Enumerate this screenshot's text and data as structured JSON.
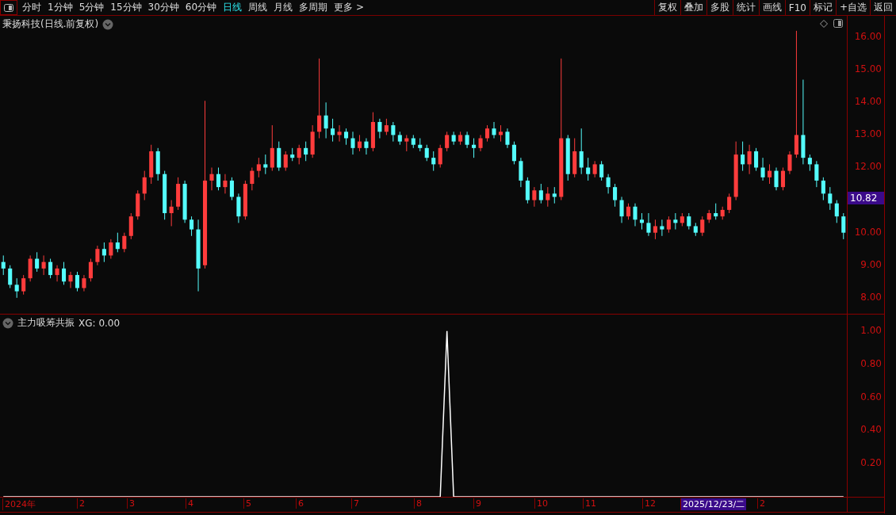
{
  "toolbar": {
    "periods": [
      {
        "label": "分时",
        "selected": false
      },
      {
        "label": "1分钟",
        "selected": false
      },
      {
        "label": "5分钟",
        "selected": false
      },
      {
        "label": "15分钟",
        "selected": false
      },
      {
        "label": "30分钟",
        "selected": false
      },
      {
        "label": "60分钟",
        "selected": false
      },
      {
        "label": "日线",
        "selected": true
      },
      {
        "label": "周线",
        "selected": false
      },
      {
        "label": "月线",
        "selected": false
      },
      {
        "label": "多周期",
        "selected": false
      }
    ],
    "more": "更多 >",
    "buttons": [
      "复权",
      "叠加",
      "多股",
      "统计",
      "画线",
      "F10",
      "标记",
      "+自选",
      "返回"
    ]
  },
  "main_chart": {
    "title": "秉扬科技(日线.前复权)",
    "current_price": "10.82",
    "chart_data": {
      "type": "candlestick",
      "ylim": [
        7.51,
        16.66
      ],
      "yticks": [
        {
          "value": 16,
          "label": "16.00"
        },
        {
          "value": 15,
          "label": "15.00"
        },
        {
          "value": 14,
          "label": "14.00"
        },
        {
          "value": 13,
          "label": "13.00"
        },
        {
          "value": 12,
          "label": "12.00"
        },
        {
          "value": 10,
          "label": "10.00"
        },
        {
          "value": 9,
          "label": "9.00"
        },
        {
          "value": 8,
          "label": "8.00"
        }
      ],
      "categories": [
        null,
        null,
        null,
        null,
        null,
        null,
        null,
        null,
        null,
        null,
        null,
        null,
        null,
        null,
        null,
        null,
        null,
        null,
        null,
        null,
        null,
        null,
        null,
        null,
        null,
        null,
        null,
        null,
        null,
        null,
        null,
        null,
        null,
        null,
        null,
        null,
        null,
        null,
        null,
        null,
        null,
        null,
        null,
        null,
        null,
        null,
        null,
        null,
        null,
        null,
        null,
        null,
        null,
        null,
        null,
        null,
        null,
        null,
        null,
        null,
        null,
        null,
        null,
        null,
        null,
        null,
        null,
        null,
        null,
        null,
        null,
        null,
        null,
        null,
        null,
        null,
        null,
        null,
        null,
        null,
        null,
        null,
        null,
        null,
        null,
        null,
        null,
        null,
        null,
        null,
        null,
        null,
        null,
        null,
        null,
        null,
        null,
        null,
        null,
        null,
        null,
        null,
        null,
        null,
        null,
        null,
        null,
        null,
        null,
        null,
        null,
        null,
        null,
        null,
        null,
        null,
        null,
        null,
        null,
        null,
        null,
        null,
        null,
        null,
        null,
        null
      ],
      "ohlc": [
        [
          9.1,
          9.3,
          8.7,
          8.9
        ],
        [
          8.9,
          9.0,
          8.3,
          8.4
        ],
        [
          8.4,
          8.6,
          8.0,
          8.2
        ],
        [
          8.2,
          8.7,
          8.1,
          8.6
        ],
        [
          8.6,
          9.3,
          8.5,
          9.2
        ],
        [
          9.2,
          9.4,
          8.8,
          8.9
        ],
        [
          8.9,
          9.3,
          8.7,
          9.1
        ],
        [
          9.1,
          9.2,
          8.6,
          8.7
        ],
        [
          8.7,
          9.0,
          8.5,
          8.9
        ],
        [
          8.9,
          9.1,
          8.4,
          8.5
        ],
        [
          8.5,
          8.8,
          8.3,
          8.7
        ],
        [
          8.7,
          8.8,
          8.2,
          8.3
        ],
        [
          8.3,
          8.7,
          8.2,
          8.6
        ],
        [
          8.6,
          9.2,
          8.5,
          9.1
        ],
        [
          9.1,
          9.6,
          9.0,
          9.5
        ],
        [
          9.5,
          9.7,
          9.1,
          9.3
        ],
        [
          9.3,
          9.8,
          9.2,
          9.7
        ],
        [
          9.7,
          10.0,
          9.4,
          9.5
        ],
        [
          9.5,
          10.0,
          9.4,
          9.9
        ],
        [
          9.9,
          10.6,
          9.8,
          10.5
        ],
        [
          10.5,
          11.3,
          10.4,
          11.2
        ],
        [
          11.2,
          11.9,
          11.0,
          11.7
        ],
        [
          11.7,
          12.7,
          11.5,
          12.5
        ],
        [
          12.5,
          12.6,
          11.6,
          11.8
        ],
        [
          11.8,
          11.9,
          10.4,
          10.6
        ],
        [
          10.6,
          11.0,
          10.2,
          10.8
        ],
        [
          10.8,
          11.7,
          10.7,
          11.5
        ],
        [
          11.5,
          11.6,
          10.3,
          10.4
        ],
        [
          10.4,
          10.5,
          9.9,
          10.1
        ],
        [
          10.1,
          10.4,
          8.2,
          8.9
        ],
        [
          9.0,
          14.05,
          8.9,
          11.6
        ],
        [
          11.6,
          12.0,
          11.3,
          11.8
        ],
        [
          11.8,
          12.0,
          11.3,
          11.4
        ],
        [
          11.4,
          11.8,
          11.2,
          11.6
        ],
        [
          11.6,
          11.7,
          11.0,
          11.1
        ],
        [
          11.1,
          11.2,
          10.3,
          10.5
        ],
        [
          10.5,
          11.6,
          10.4,
          11.5
        ],
        [
          11.5,
          12.0,
          11.3,
          11.9
        ],
        [
          11.9,
          12.3,
          11.7,
          12.1
        ],
        [
          12.1,
          12.4,
          11.8,
          12.0
        ],
        [
          12.0,
          13.3,
          11.9,
          12.6
        ],
        [
          12.6,
          12.8,
          11.9,
          12.0
        ],
        [
          12.0,
          12.5,
          11.9,
          12.4
        ],
        [
          12.4,
          12.6,
          12.2,
          12.3
        ],
        [
          12.3,
          12.7,
          12.1,
          12.6
        ],
        [
          12.6,
          12.8,
          12.2,
          12.4
        ],
        [
          12.4,
          13.3,
          12.3,
          13.1
        ],
        [
          13.1,
          15.35,
          12.9,
          13.6
        ],
        [
          13.6,
          14.0,
          12.9,
          13.2
        ],
        [
          13.2,
          13.5,
          12.8,
          13.0
        ],
        [
          13.0,
          13.3,
          12.8,
          13.1
        ],
        [
          13.1,
          13.2,
          12.7,
          12.9
        ],
        [
          12.9,
          13.1,
          12.4,
          12.6
        ],
        [
          12.6,
          13.0,
          12.5,
          12.8
        ],
        [
          12.8,
          12.9,
          12.4,
          12.6
        ],
        [
          12.6,
          13.7,
          12.5,
          13.4
        ],
        [
          13.4,
          13.5,
          12.9,
          13.1
        ],
        [
          13.1,
          13.5,
          13.0,
          13.3
        ],
        [
          13.3,
          13.4,
          12.8,
          13.0
        ],
        [
          13.0,
          13.1,
          12.7,
          12.8
        ],
        [
          12.8,
          13.0,
          12.5,
          12.9
        ],
        [
          12.9,
          13.0,
          12.6,
          12.7
        ],
        [
          12.7,
          12.9,
          12.5,
          12.6
        ],
        [
          12.6,
          12.7,
          12.2,
          12.3
        ],
        [
          12.3,
          12.5,
          11.9,
          12.1
        ],
        [
          12.1,
          12.7,
          12.0,
          12.6
        ],
        [
          12.6,
          13.1,
          12.5,
          13.0
        ],
        [
          13.0,
          13.1,
          12.7,
          12.8
        ],
        [
          12.8,
          13.1,
          12.7,
          13.0
        ],
        [
          13.0,
          13.1,
          12.6,
          12.7
        ],
        [
          12.7,
          12.9,
          12.3,
          12.6
        ],
        [
          12.6,
          13.0,
          12.5,
          12.9
        ],
        [
          12.9,
          13.3,
          12.8,
          13.2
        ],
        [
          13.2,
          13.4,
          12.9,
          13.0
        ],
        [
          13.0,
          13.3,
          12.8,
          13.1
        ],
        [
          13.1,
          13.2,
          12.6,
          12.7
        ],
        [
          12.7,
          12.8,
          12.1,
          12.2
        ],
        [
          12.2,
          12.3,
          11.4,
          11.6
        ],
        [
          11.6,
          11.7,
          10.9,
          11.0
        ],
        [
          11.0,
          11.4,
          10.8,
          11.3
        ],
        [
          11.3,
          11.5,
          10.9,
          11.0
        ],
        [
          11.0,
          11.4,
          10.8,
          11.2
        ],
        [
          11.2,
          11.4,
          10.9,
          11.1
        ],
        [
          11.1,
          15.35,
          11.0,
          12.9
        ],
        [
          12.9,
          13.0,
          11.6,
          11.8
        ],
        [
          11.8,
          12.9,
          11.7,
          12.5
        ],
        [
          12.5,
          13.2,
          11.8,
          12.0
        ],
        [
          12.0,
          12.3,
          11.6,
          11.8
        ],
        [
          11.8,
          12.2,
          11.7,
          12.1
        ],
        [
          12.1,
          12.2,
          11.6,
          11.7
        ],
        [
          11.7,
          11.8,
          11.2,
          11.4
        ],
        [
          11.4,
          11.5,
          10.8,
          11.0
        ],
        [
          11.0,
          11.1,
          10.3,
          10.5
        ],
        [
          10.5,
          10.9,
          10.4,
          10.8
        ],
        [
          10.8,
          10.9,
          10.2,
          10.4
        ],
        [
          10.4,
          10.6,
          10.1,
          10.3
        ],
        [
          10.3,
          10.6,
          9.9,
          10.0
        ],
        [
          10.0,
          10.4,
          9.8,
          10.2
        ],
        [
          10.2,
          10.4,
          9.9,
          10.1
        ],
        [
          10.1,
          10.5,
          10.0,
          10.4
        ],
        [
          10.4,
          10.6,
          10.1,
          10.3
        ],
        [
          10.3,
          10.6,
          10.2,
          10.5
        ],
        [
          10.5,
          10.6,
          10.1,
          10.2
        ],
        [
          10.2,
          10.3,
          9.9,
          10.0
        ],
        [
          10.0,
          10.5,
          9.9,
          10.4
        ],
        [
          10.4,
          10.7,
          10.3,
          10.6
        ],
        [
          10.6,
          10.9,
          10.4,
          10.5
        ],
        [
          10.5,
          10.8,
          10.4,
          10.7
        ],
        [
          10.7,
          11.2,
          10.6,
          11.1
        ],
        [
          11.1,
          12.8,
          11.0,
          12.4
        ],
        [
          12.4,
          12.8,
          11.9,
          12.1
        ],
        [
          12.1,
          12.7,
          11.8,
          12.5
        ],
        [
          12.5,
          12.6,
          11.9,
          12.0
        ],
        [
          12.0,
          12.3,
          11.6,
          11.7
        ],
        [
          11.7,
          12.1,
          11.5,
          11.9
        ],
        [
          11.9,
          12.0,
          11.3,
          11.4
        ],
        [
          11.4,
          12.0,
          11.3,
          11.9
        ],
        [
          11.9,
          12.5,
          11.8,
          12.4
        ],
        [
          12.4,
          16.2,
          12.3,
          13.0
        ],
        [
          13.0,
          14.7,
          12.1,
          12.3
        ],
        [
          12.3,
          12.4,
          11.9,
          12.1
        ],
        [
          12.1,
          12.2,
          11.4,
          11.6
        ],
        [
          11.6,
          11.7,
          11.0,
          11.2
        ],
        [
          11.2,
          11.4,
          10.7,
          10.9
        ],
        [
          10.9,
          11.0,
          10.3,
          10.5
        ],
        [
          10.5,
          10.6,
          9.8,
          10.0
        ]
      ]
    }
  },
  "indicator": {
    "title": "主力吸筹共振",
    "reading": "XG: 0.00",
    "chart_data": {
      "type": "line",
      "categories": [
        null,
        null,
        null,
        null,
        null,
        null,
        null,
        null,
        null,
        null,
        null,
        null,
        null,
        null,
        null,
        null,
        null,
        null,
        null,
        null,
        null,
        null,
        null,
        null,
        null,
        null,
        null,
        null,
        null,
        null,
        null,
        null,
        null,
        null,
        null,
        null,
        null,
        null,
        null,
        null,
        null,
        null,
        null,
        null,
        null,
        null,
        null,
        null,
        null,
        null,
        null,
        null,
        null,
        null,
        null,
        null,
        null,
        null,
        null,
        null,
        null,
        null,
        null,
        null,
        null,
        null,
        null,
        null,
        null,
        null,
        null,
        null,
        null,
        null,
        null,
        null,
        null,
        null,
        null,
        null,
        null,
        null,
        null,
        null,
        null,
        null,
        null,
        null,
        null,
        null,
        null,
        null,
        null,
        null,
        null,
        null,
        null,
        null,
        null,
        null,
        null,
        null,
        null,
        null,
        null,
        null,
        null,
        null,
        null,
        null,
        null,
        null,
        null,
        null,
        null,
        null,
        null,
        null,
        null,
        null,
        null,
        null,
        null,
        null,
        null,
        null
      ],
      "series": [
        {
          "color": "#ffffff",
          "values": [
            0,
            0,
            0,
            0,
            0,
            0,
            0,
            0,
            0,
            0,
            0,
            0,
            0,
            0,
            0,
            0,
            0,
            0,
            0,
            0,
            0,
            0,
            0,
            0,
            0,
            0,
            0,
            0,
            0,
            0,
            0,
            0,
            0,
            0,
            0,
            0,
            0,
            0,
            0,
            0,
            0,
            0,
            0,
            0,
            0,
            0,
            0,
            0,
            0,
            0,
            0,
            0,
            0,
            0,
            0,
            0,
            0,
            0,
            0,
            0,
            0,
            0,
            0,
            0,
            0,
            0,
            1.0,
            0,
            0,
            0,
            0,
            0,
            0,
            0,
            0,
            0,
            0,
            0,
            0,
            0,
            0,
            0,
            0,
            0,
            0,
            0,
            0,
            0,
            0,
            0,
            0,
            0,
            0,
            0,
            0,
            0,
            0,
            0,
            0,
            0,
            0,
            0,
            0,
            0,
            0,
            0,
            0,
            0,
            0,
            0,
            0,
            0,
            0,
            0,
            0,
            0,
            0,
            0,
            0,
            0,
            0,
            0,
            0,
            0,
            0,
            0
          ]
        }
      ],
      "ylim": [
        0,
        1.1
      ],
      "yticks": [
        {
          "value": 1.0,
          "label": "1.00"
        },
        {
          "value": 0.8,
          "label": "0.80"
        },
        {
          "value": 0.6,
          "label": "0.60"
        },
        {
          "value": 0.4,
          "label": "0.40"
        },
        {
          "value": 0.2,
          "label": "0.20"
        }
      ]
    }
  },
  "date_axis": [
    {
      "label": "2024年",
      "selected": false
    },
    {
      "label": "2",
      "selected": false
    },
    {
      "label": "3",
      "selected": false
    },
    {
      "label": "4",
      "selected": false
    },
    {
      "label": "5",
      "selected": false
    },
    {
      "label": "6",
      "selected": false
    },
    {
      "label": "7",
      "selected": false
    },
    {
      "label": "8",
      "selected": false
    },
    {
      "label": "9",
      "selected": false
    },
    {
      "label": "10",
      "selected": false
    },
    {
      "label": "11",
      "selected": false
    },
    {
      "label": "12",
      "selected": false
    },
    {
      "label": "2025/12/23/二",
      "selected": true
    },
    {
      "label": "2",
      "selected": false
    }
  ]
}
